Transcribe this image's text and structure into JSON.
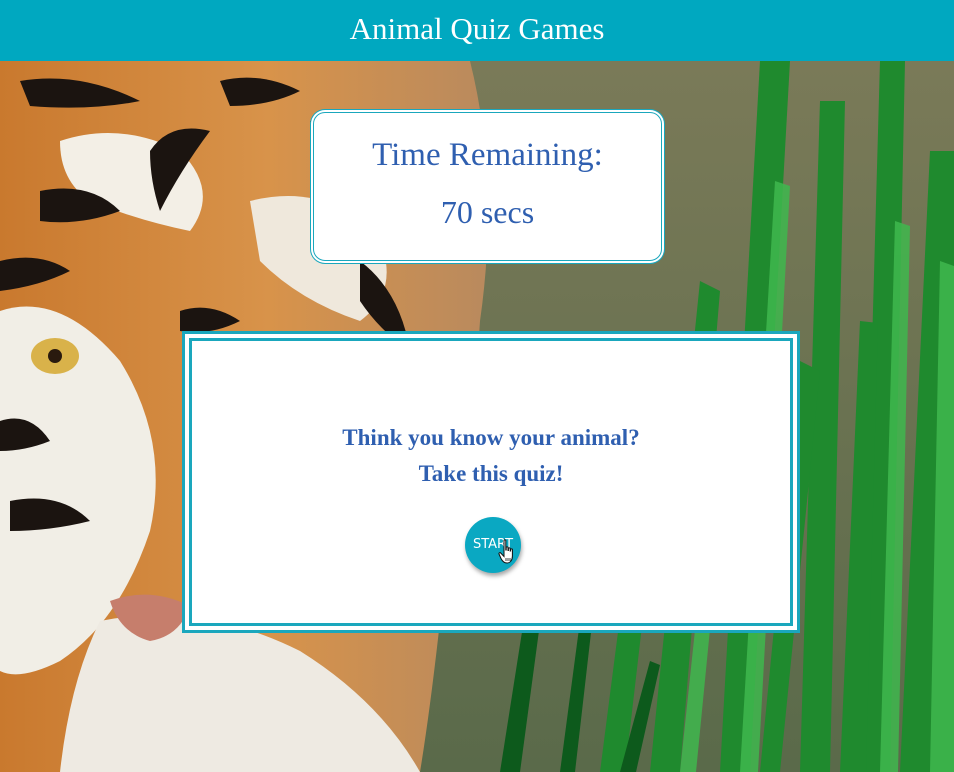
{
  "header": {
    "title": "Animal Quiz Games"
  },
  "timer": {
    "label": "Time Remaining:",
    "value": "70 secs"
  },
  "quiz": {
    "prompt_line1": "Think you know your animal?",
    "prompt_line2": "Take this quiz!",
    "start_label": "START"
  },
  "background": {
    "subject": "tiger-in-grass-photo"
  },
  "colors": {
    "accent": "#00a8c0",
    "text_blue": "#2f5fb0",
    "card_bg": "#ffffff"
  },
  "icons": {
    "pointer": "hand-pointer-icon"
  }
}
